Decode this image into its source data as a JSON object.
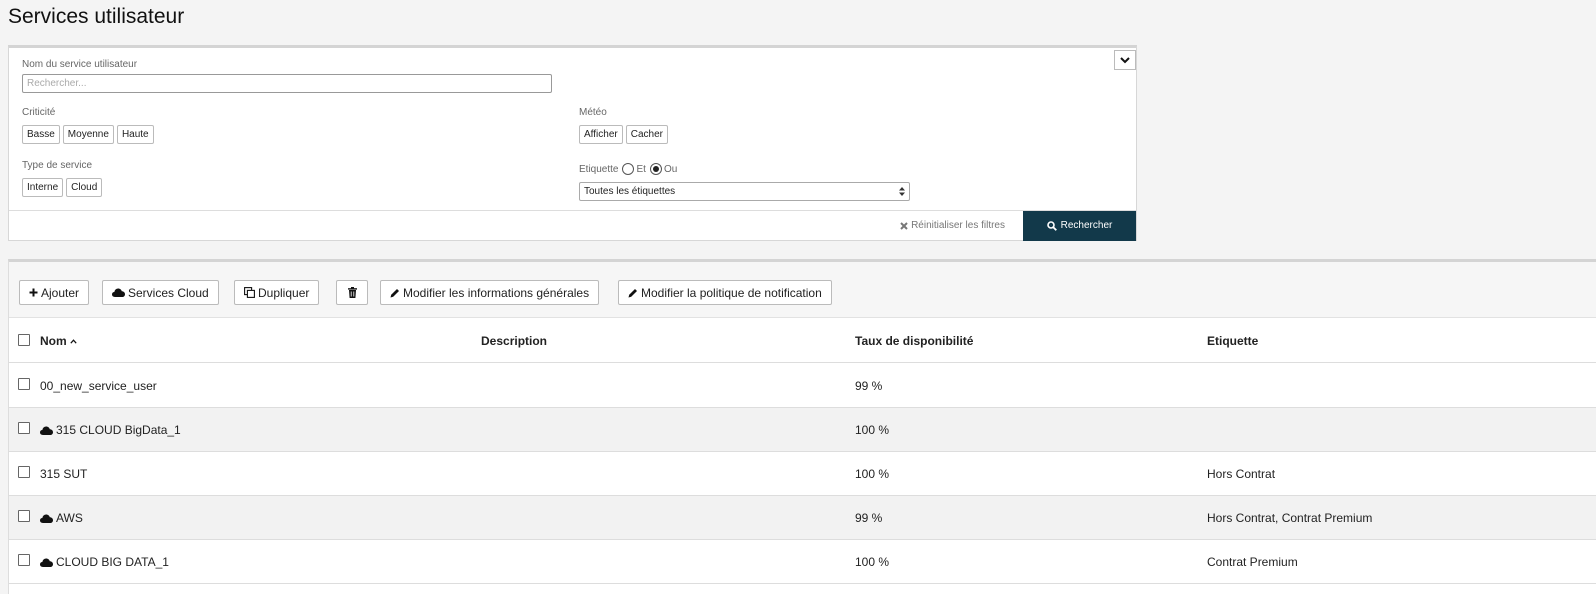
{
  "page": {
    "title": "Services utilisateur"
  },
  "filters": {
    "service_name_label": "Nom du service utilisateur",
    "search_placeholder": "Rechercher...",
    "criticality_label": "Criticité",
    "criticality_options": [
      "Basse",
      "Moyenne",
      "Haute"
    ],
    "weather_label": "Météo",
    "weather_options": [
      "Afficher",
      "Cacher"
    ],
    "service_type_label": "Type de service",
    "service_type_options": [
      "Interne",
      "Cloud"
    ],
    "tag_label": "Etiquette",
    "tag_and": "Et",
    "tag_or": "Ou",
    "tag_mode_selected": "Ou",
    "tag_select_value": "Toutes les étiquettes",
    "reset_label": "Réinitialiser les filtres",
    "search_label": "Rechercher"
  },
  "toolbar": {
    "add": "Ajouter",
    "cloud_services": "Services Cloud",
    "duplicate": "Dupliquer",
    "edit_general": "Modifier les informations générales",
    "edit_notification": "Modifier la politique de notification"
  },
  "table": {
    "columns": {
      "name": "Nom",
      "description": "Description",
      "availability": "Taux de disponibilité",
      "tag": "Etiquette"
    },
    "sort": {
      "column": "name",
      "direction": "asc"
    },
    "rows": [
      {
        "name": "00_new_service_user",
        "cloud": false,
        "description": "",
        "availability": "99 %",
        "tag": ""
      },
      {
        "name": "315 CLOUD BigData_1",
        "cloud": true,
        "description": "",
        "availability": "100 %",
        "tag": ""
      },
      {
        "name": "315 SUT",
        "cloud": false,
        "description": "",
        "availability": "100 %",
        "tag": "Hors Contrat"
      },
      {
        "name": "AWS",
        "cloud": true,
        "description": "",
        "availability": "99 %",
        "tag": "Hors Contrat, Contrat Premium"
      },
      {
        "name": "CLOUD BIG DATA_1",
        "cloud": true,
        "description": "",
        "availability": "100 %",
        "tag": "Contrat Premium"
      }
    ]
  },
  "icons": {
    "collapse": "chevron-down-icon",
    "reset": "times-icon",
    "search": "search-icon",
    "add": "plus-icon",
    "cloud": "cloud-icon",
    "duplicate": "copy-icon",
    "delete": "trash-icon",
    "edit": "pencil-icon",
    "sort": "chevron-up-icon"
  },
  "colors": {
    "primary_button": "#12394a",
    "alt_row": "#f2f2f2"
  }
}
